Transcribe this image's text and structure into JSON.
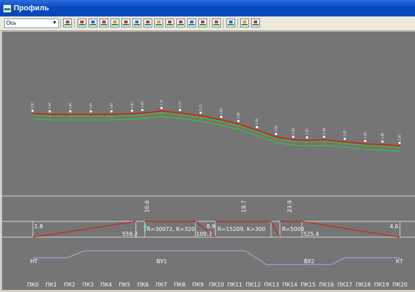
{
  "window": {
    "title": "Профиль"
  },
  "toolbar": {
    "layer_select": "Ось"
  },
  "profile": {
    "pickets": [
      "ПК0",
      "ПК1",
      "ПК2",
      "ПК3",
      "ПК4",
      "ПК5",
      "ПК6",
      "ПК7",
      "ПК8",
      "ПК9",
      "ПК10",
      "ПК11",
      "ПК12",
      "ПК13",
      "ПК14",
      "ПК15",
      "ПК16",
      "ПК17",
      "ПК18",
      "ПК19",
      "ПК20"
    ],
    "point_markers": [
      "1.57",
      "1.59",
      "1.60",
      "1.61",
      "1.62",
      "1.63",
      "1.65",
      "1.71",
      "2.37",
      "2.21",
      "2.00",
      "1.85",
      "1.59",
      "1.50",
      "1.49",
      "1.32",
      "1.38",
      "1.42",
      "1.45",
      "1.48",
      "1.50"
    ],
    "slope_values": [
      "10.6",
      "19.7",
      "23.9"
    ],
    "slope_left": "1.8",
    "slope_right": "4.6",
    "curve_labels": [
      "R=30072, K=320",
      "R=15209, K=300",
      "R=5000"
    ],
    "station_values": [
      "559.2",
      "8.9",
      "109.3",
      "525.4"
    ],
    "horizontal_labels": {
      "start": "НТ",
      "curve1": "ВУ1",
      "curve2": "ВУ2",
      "end": "КТ"
    }
  },
  "colors": {
    "canvas_bg": "#757575",
    "design_line": "#cc2222",
    "ground_line": "#33cc33",
    "horizontal_line": "#9ab8e8",
    "text": "#ffffff"
  }
}
